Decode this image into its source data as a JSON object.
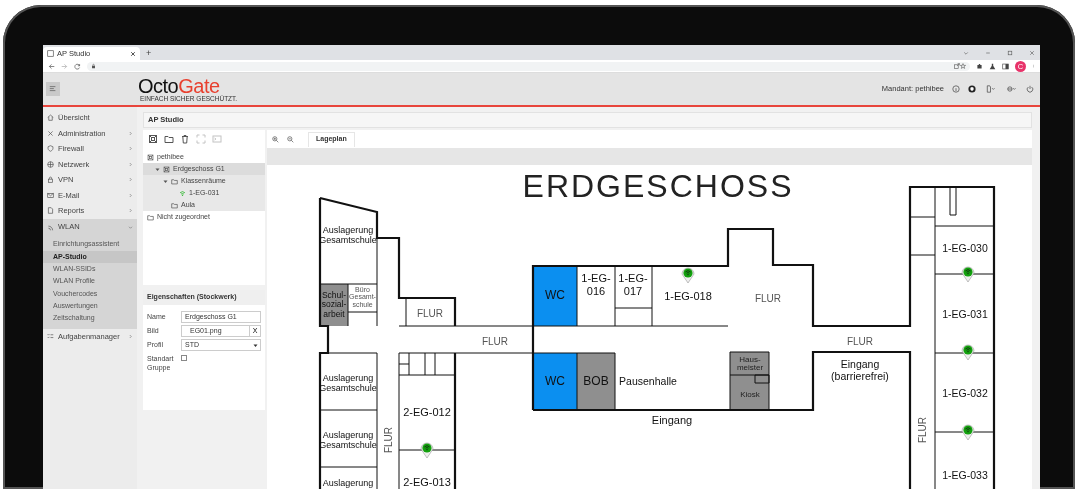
{
  "browser": {
    "tabs": [
      {
        "title": "AP Studio",
        "selected": true
      }
    ],
    "new_tab": "+",
    "profile_initial": "C"
  },
  "header": {
    "logo_dark": "Octo",
    "logo_accent": "Gate",
    "tagline": "EINFACH SICHER GESCHÜTZT.",
    "tenant": "Mandant: pethibee"
  },
  "sidebar": {
    "items": [
      {
        "label": "Übersicht",
        "expanded": false,
        "has_children": false
      },
      {
        "label": "Administration",
        "expanded": false,
        "has_children": true
      },
      {
        "label": "Firewall",
        "expanded": false,
        "has_children": true
      },
      {
        "label": "Netzwerk",
        "expanded": false,
        "has_children": true
      },
      {
        "label": "VPN",
        "expanded": false,
        "has_children": true
      },
      {
        "label": "E-Mail",
        "expanded": false,
        "has_children": true
      },
      {
        "label": "Reports",
        "expanded": false,
        "has_children": true
      },
      {
        "label": "WLAN",
        "expanded": true,
        "has_children": true,
        "children": [
          {
            "label": "Einrichtungsassistent",
            "selected": false
          },
          {
            "label": "AP-Studio",
            "selected": true
          },
          {
            "label": "WLAN-SSIDs",
            "selected": false
          },
          {
            "label": "WLAN Profile",
            "selected": false
          },
          {
            "label": "Vouchercodes",
            "selected": false
          },
          {
            "label": "Auswertungen",
            "selected": false
          },
          {
            "label": "Zeitschaltung",
            "selected": false
          }
        ]
      },
      {
        "label": "Aufgabenmanager",
        "expanded": false,
        "has_children": true
      }
    ]
  },
  "panel_title": "AP Studio",
  "tree_tools": [
    {
      "kind": "floor",
      "disabled": false
    },
    {
      "kind": "folder",
      "disabled": false
    },
    {
      "kind": "delete",
      "disabled": false
    },
    {
      "kind": "expand",
      "disabled": true
    },
    {
      "kind": "console",
      "disabled": true
    }
  ],
  "tree": [
    {
      "label": "pethibee",
      "kind": "floor",
      "selected": false,
      "children": [
        {
          "label": "Erdgeschoss G1",
          "kind": "floor",
          "selected": true,
          "expanded": true,
          "children": [
            {
              "label": "Klassenräume",
              "kind": "folder",
              "selected": false,
              "expanded": true,
              "children": [
                {
                  "label": "1-EG-031",
                  "kind": "ap",
                  "selected": false
                }
              ]
            },
            {
              "label": "Aula",
              "kind": "folder",
              "selected": false
            }
          ]
        }
      ]
    },
    {
      "label": "Nicht zugeordnet",
      "kind": "folder",
      "selected": false
    }
  ],
  "properties": {
    "title": "Eigenschaften (Stockwerk)",
    "fields": [
      {
        "label": "Name",
        "kind": "text",
        "value": "Erdgeschoss G1"
      },
      {
        "label": "Bild",
        "kind": "file",
        "value": "EG01.png",
        "clear": "X"
      },
      {
        "label": "Profil",
        "kind": "select",
        "value": "STD"
      },
      {
        "label": "Standart Gruppe",
        "kind": "checkbox",
        "checked": false
      }
    ]
  },
  "plan": {
    "tabs": [
      {
        "label": "Lageplan",
        "selected": true
      }
    ],
    "title": "ERDGESCHOSS",
    "labels": [
      {
        "text": "Auslagerung Gesamtschule"
      },
      {
        "text": "Schul- sozial- arbeit",
        "color": "#8f8f8f"
      },
      {
        "text": "Büro Gesamt- schule"
      },
      {
        "text": "FLUR"
      },
      {
        "text": "FLUR"
      },
      {
        "text": "WC",
        "color": "#0b8ff0"
      },
      {
        "text": "1-EG- 016"
      },
      {
        "text": "1-EG- 017"
      },
      {
        "text": "1-EG-018"
      },
      {
        "text": "FLUR"
      },
      {
        "text": "FLUR"
      },
      {
        "text": "1-EG-030"
      },
      {
        "text": "1-EG-031"
      },
      {
        "text": "1-EG-032"
      },
      {
        "text": "1-EG-033"
      },
      {
        "text": "Auslagerung Gesamtschule"
      },
      {
        "text": "Auslagerung Gesamtschule"
      },
      {
        "text": "Auslagerung"
      },
      {
        "text": "FLUR"
      },
      {
        "text": "2-EG-012"
      },
      {
        "text": "2-EG-013"
      },
      {
        "text": "WC",
        "color": "#0b8ff0"
      },
      {
        "text": "BOB",
        "color": "#8f8f8f"
      },
      {
        "text": "Pausenhalle"
      },
      {
        "text": "Haus- meister",
        "color": "#8f8f8f"
      },
      {
        "text": "Kiosk"
      },
      {
        "text": "Eingang"
      },
      {
        "text": "Eingang (barrierefrei)"
      },
      {
        "text": "FLUR"
      }
    ]
  }
}
